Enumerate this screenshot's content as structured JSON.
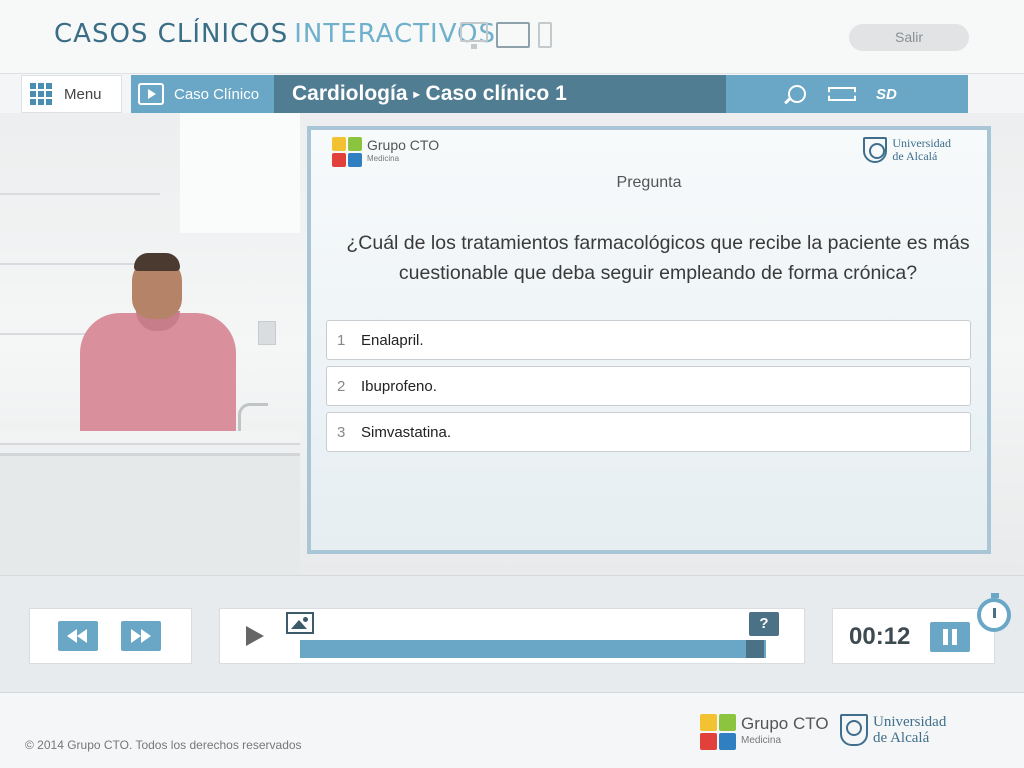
{
  "header": {
    "brand_part1": "CASOS CLÍNICOS",
    "brand_part2": "INTERACTIVOS",
    "exit_label": "Salir"
  },
  "nav": {
    "menu_label": "Menu",
    "case_label": "Caso Clínico",
    "breadcrumb_section": "Cardiología",
    "breadcrumb_separator": "▸",
    "breadcrumb_case": "Caso clínico 1",
    "quality_label": "SD"
  },
  "panel": {
    "cto_logo_name": "Grupo CTO",
    "cto_logo_sub": "Medicina",
    "uah_line1": "Universidad",
    "uah_line2": "de Alcalá",
    "title": "Pregunta",
    "question": "¿Cuál de los tratamientos farmacológicos que recibe la paciente es más cuestionable que deba seguir empleando de forma crónica?",
    "options": [
      {
        "num": "1",
        "text": "Enalapril."
      },
      {
        "num": "2",
        "text": "Ibuprofeno."
      },
      {
        "num": "3",
        "text": "Simvastatina."
      }
    ]
  },
  "player": {
    "question_marker": "?",
    "time": "00:12"
  },
  "footer": {
    "copyright": "© 2014 Grupo CTO. Todos los derechos reservados",
    "cto_logo_name": "Grupo CTO",
    "cto_logo_sub": "Medicina",
    "uah_line1": "Universidad",
    "uah_line2": "de Alcalá"
  },
  "colors": {
    "accent": "#6aa7c6",
    "accent_dark": "#517d93",
    "logo_yellow": "#f2c233",
    "logo_green": "#8dc43f",
    "logo_red": "#e2403a",
    "logo_blue": "#2f7fc1"
  },
  "icons": [
    "grid-icon",
    "film-icon",
    "zoom-icon",
    "screen-icon",
    "rewind-icon",
    "forward-icon",
    "play-icon",
    "image-icon",
    "pause-icon",
    "timer-icon"
  ]
}
